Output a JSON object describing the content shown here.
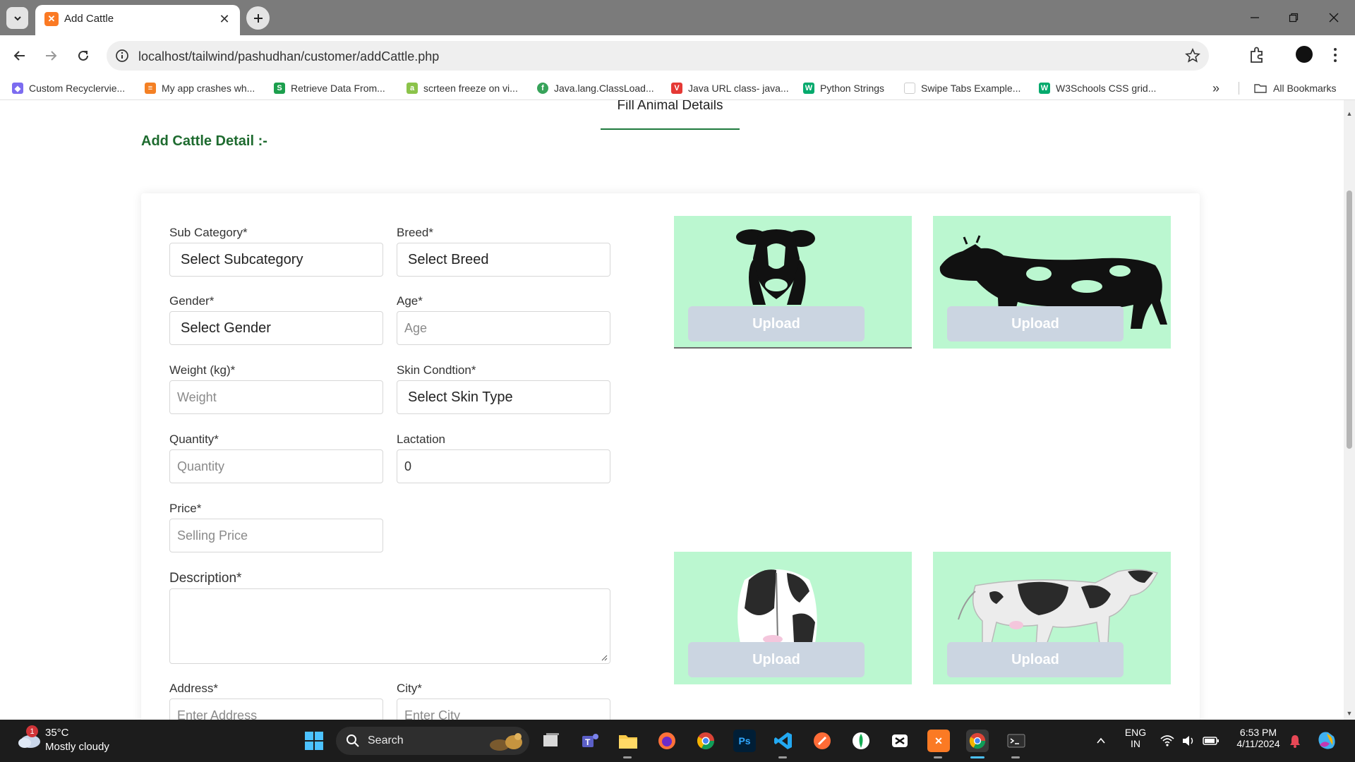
{
  "browser": {
    "tab_title": "Add Cattle",
    "tab_favicon": "xampp-icon",
    "url": "localhost/tailwind/pashudhan/customer/addCattle.php",
    "bookmarks": [
      {
        "label": "Custom Recyclervie...",
        "icon": "puzzle-icon",
        "color": "#7c6cf0"
      },
      {
        "label": "My app crashes wh...",
        "icon": "stack-overflow-icon",
        "color": "#f48024"
      },
      {
        "label": "Retrieve Data From...",
        "icon": "s-icon",
        "color": "#1c9f4d"
      },
      {
        "label": "scrteen freeze on vi...",
        "icon": "a-icon",
        "color": "#8bc34a"
      },
      {
        "label": "Java.lang.ClassLoad...",
        "icon": "f-icon",
        "color": "#37a35a"
      },
      {
        "label": "Java URL class- java...",
        "icon": "v-icon",
        "color": "#e53935"
      },
      {
        "label": "Python Strings",
        "icon": "w3-icon",
        "color": "#04aa6d"
      },
      {
        "label": "Swipe Tabs Example...",
        "icon": "blank-page-icon",
        "color": "#ffffff"
      },
      {
        "label": "W3Schools CSS grid...",
        "icon": "w3-icon",
        "color": "#04aa6d"
      }
    ],
    "all_bookmarks_label": "All Bookmarks"
  },
  "page": {
    "tab_heading": "Fill Animal Details",
    "section_title": "Add Cattle Detail :-",
    "form": {
      "sub_category": {
        "label": "Sub Category*",
        "value": "Select Subcategory"
      },
      "breed": {
        "label": "Breed*",
        "value": "Select Breed"
      },
      "gender": {
        "label": "Gender*",
        "value": "Select Gender"
      },
      "age": {
        "label": "Age*",
        "placeholder": "Age"
      },
      "weight": {
        "label": "Weight (kg)*",
        "placeholder": "Weight"
      },
      "skin": {
        "label": "Skin Condtion*",
        "value": "Select Skin Type"
      },
      "quantity": {
        "label": "Quantity*",
        "placeholder": "Quantity"
      },
      "lactation": {
        "label": "Lactation",
        "value": "0"
      },
      "price": {
        "label": "Price*",
        "placeholder": "Selling Price"
      },
      "description": {
        "label": "Description*",
        "value": ""
      },
      "address": {
        "label": "Address*",
        "placeholder": "Enter Address"
      },
      "city": {
        "label": "City*",
        "placeholder": "Enter City"
      }
    },
    "uploads": [
      {
        "button": "Upload",
        "image": "cow-front-view"
      },
      {
        "button": "Upload",
        "image": "cow-side-silhouette"
      },
      {
        "button": "Upload",
        "image": "cow-rear-view"
      },
      {
        "button": "Upload",
        "image": "cow-side-view"
      }
    ],
    "colors": {
      "accent_green": "#1e6b2f",
      "tile_bg": "#bbf7d0",
      "upload_btn": "#cbd5e1"
    }
  },
  "taskbar": {
    "weather": {
      "temp": "35°C",
      "desc": "Mostly cloudy",
      "badge": "1"
    },
    "search_label": "Search",
    "lang_top": "ENG",
    "lang_bottom": "IN",
    "time": "6:53 PM",
    "date": "4/11/2024"
  }
}
